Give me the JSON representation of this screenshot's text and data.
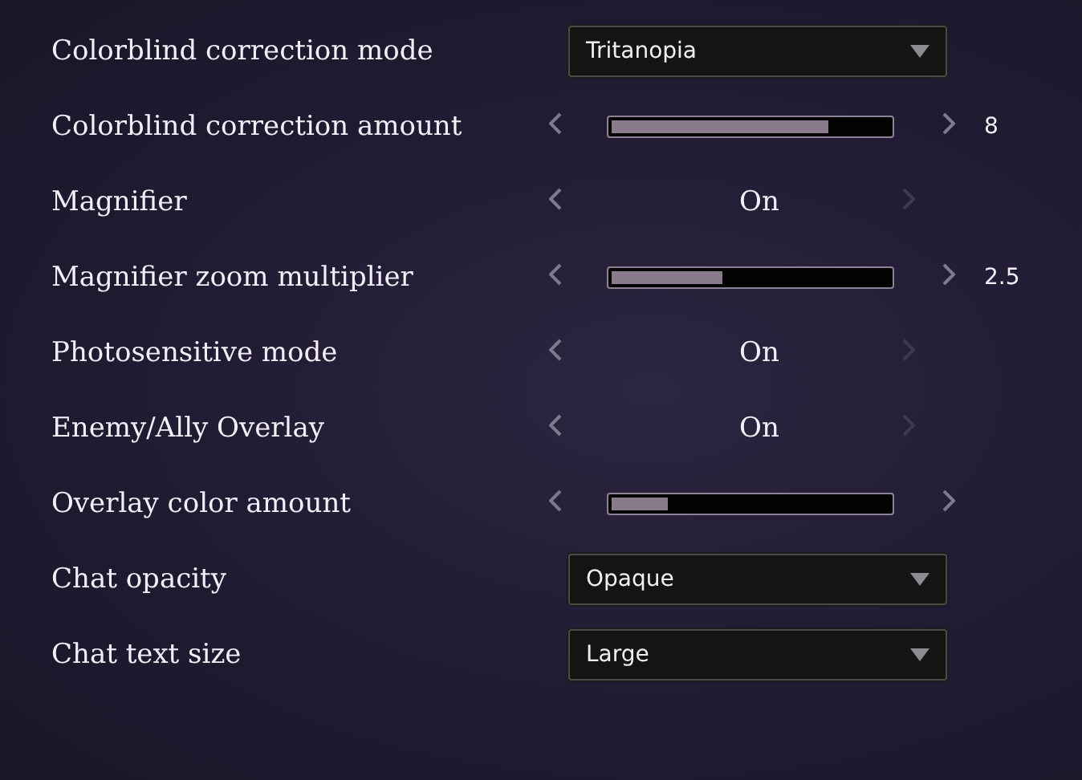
{
  "settings": [
    {
      "kind": "dropdown",
      "label": "Colorblind correction mode",
      "value": "Tritanopia"
    },
    {
      "kind": "slider",
      "label": "Colorblind correction amount",
      "level": 0.78,
      "reading": "8",
      "next_enabled": true
    },
    {
      "kind": "toggle",
      "label": "Magnifier",
      "value": "On",
      "next_enabled": false
    },
    {
      "kind": "slider",
      "label": "Magnifier zoom multiplier",
      "level": 0.4,
      "reading": "2.5",
      "next_enabled": true
    },
    {
      "kind": "toggle",
      "label": "Photosensitive mode",
      "value": "On",
      "next_enabled": false
    },
    {
      "kind": "toggle",
      "label": "Enemy/Ally Overlay",
      "value": "On",
      "next_enabled": false
    },
    {
      "kind": "slider",
      "label": "Overlay color amount",
      "level": 0.2,
      "next_enabled": true
    },
    {
      "kind": "dropdown",
      "label": "Chat opacity",
      "value": "Opaque"
    },
    {
      "kind": "dropdown",
      "label": "Chat text size",
      "value": "Large"
    }
  ]
}
